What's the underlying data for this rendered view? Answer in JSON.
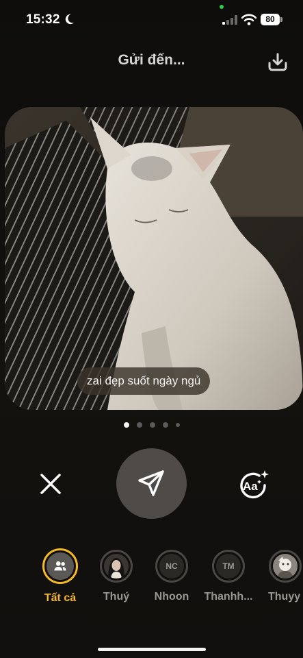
{
  "status_bar": {
    "time": "15:32",
    "battery": "80",
    "icons": [
      "moon-icon",
      "signal-icon",
      "wifi-icon",
      "battery-icon"
    ]
  },
  "header": {
    "title": "Gửi đến...",
    "download_icon": "download-icon"
  },
  "photo": {
    "caption": "zai đẹp suốt ngày ngủ"
  },
  "pager": {
    "count": 5,
    "active_index": 0
  },
  "controls": {
    "close_icon": "close-icon",
    "send_icon": "send-icon",
    "text_style_label": "Aa"
  },
  "recipients": [
    {
      "label": "Tất cả",
      "initials": "",
      "selected": true
    },
    {
      "label": "Thuý",
      "initials": "",
      "selected": false
    },
    {
      "label": "Nhoon",
      "initials": "NC",
      "selected": false
    },
    {
      "label": "Thanhh...",
      "initials": "TM",
      "selected": false
    },
    {
      "label": "Thuyy",
      "initials": "",
      "selected": false
    }
  ],
  "colors": {
    "accent": "#f5bb2b",
    "send_button": "#4e4b48",
    "background": "#100f0d"
  }
}
